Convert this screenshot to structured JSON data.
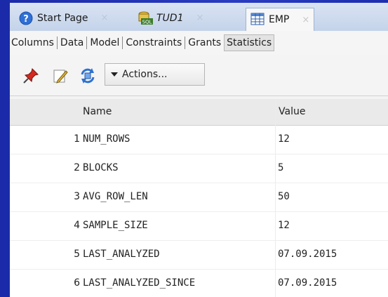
{
  "tabs": [
    {
      "label": "Start Page",
      "icon": "help-icon",
      "italic": false,
      "active": false
    },
    {
      "label": "TUD1",
      "icon": "sql-worksheet-icon",
      "italic": true,
      "active": false
    },
    {
      "label": "EMP",
      "icon": "table-icon",
      "italic": false,
      "active": true
    }
  ],
  "close_glyph": "×",
  "subtabs": [
    "Columns",
    "Data",
    "Model",
    "Constraints",
    "Grants",
    "Statistics"
  ],
  "toolbar": {
    "actions_label": "Actions..."
  },
  "grid": {
    "headers": {
      "name": "Name",
      "value": "Value"
    },
    "rows": [
      {
        "num": "1",
        "name": "NUM_ROWS",
        "value": "12"
      },
      {
        "num": "2",
        "name": "BLOCKS",
        "value": "5"
      },
      {
        "num": "3",
        "name": "AVG_ROW_LEN",
        "value": "50"
      },
      {
        "num": "4",
        "name": "SAMPLE_SIZE",
        "value": "12"
      },
      {
        "num": "5",
        "name": "LAST_ANALYZED",
        "value": "07.09.2015"
      },
      {
        "num": "6",
        "name": "LAST_ANALYZED_SINCE",
        "value": "07.09.2015"
      }
    ]
  },
  "colors": {
    "background": "#2236b5",
    "accent": "#1a2aa8"
  }
}
